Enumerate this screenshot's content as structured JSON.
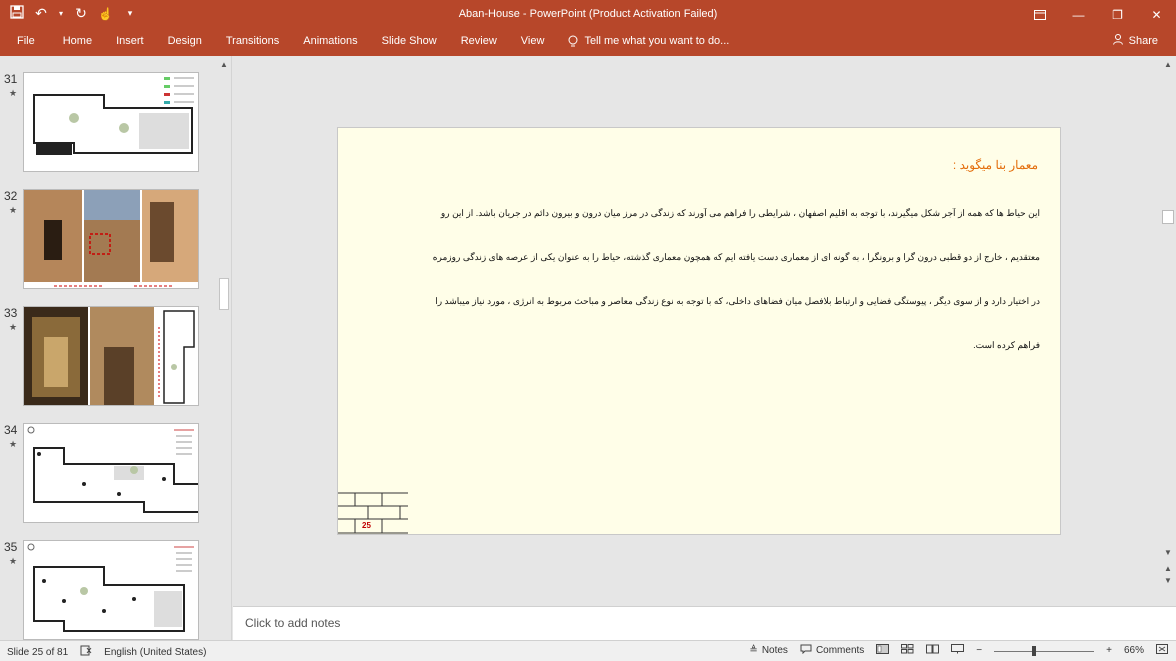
{
  "titlebar": {
    "title": "Aban-House  -  PowerPoint (Product Activation Failed)",
    "qat_icons": [
      "save-icon",
      "undo-icon",
      "redo-icon",
      "touch-mode-icon",
      "customize-icon"
    ]
  },
  "ribbon": {
    "tabs": [
      "File",
      "Home",
      "Insert",
      "Design",
      "Transitions",
      "Animations",
      "Slide Show",
      "Review",
      "View"
    ],
    "tell_me": "Tell me what you want to do...",
    "share": "Share"
  },
  "thumbnails": [
    {
      "num": "31",
      "star": "★"
    },
    {
      "num": "32",
      "star": "★"
    },
    {
      "num": "33",
      "star": "★"
    },
    {
      "num": "34",
      "star": "★"
    },
    {
      "num": "35",
      "star": "★"
    }
  ],
  "slide": {
    "heading": "معمار بنا میگوید :",
    "paragraphs": [
      "این حیاط ها که همه از آجر شکل میگیرند، با توجه به اقلیم اصفهان ، شرایطی را فراهم می آورند که زندگی در مرز میان درون و بیرون دائم در جریان باشد. از این رو",
      "معتقدیم ، خارج از دو قطبی درون گرا و برونگرا ، به گونه ای از معماری دست یافته ایم که همچون معماری گذشته، حیاط را به عنوان یکی از عرصه های زندگی روزمره",
      "در اختیار دارد و از سوی دیگر ، پیوستگی فضایی و ارتباط بلافصل میان فضاهای داخلی، که با توجه به نوع زندگی معاصر و مباحث مربوط به انرژی ، مورد نیاز میباشد را",
      "فراهم کرده است."
    ],
    "slide_number": "25"
  },
  "notes": {
    "placeholder": "Click to add notes"
  },
  "status": {
    "slide_info": "Slide 25 of 81",
    "language": "English (United States)",
    "notes_label": "Notes",
    "comments_label": "Comments",
    "zoom": "66%",
    "zoom_fraction": 0.4
  },
  "colors": {
    "accent": "#b7472a",
    "slide_bg": "#fffee8",
    "heading": "#e36c0a",
    "slide_number": "#c00000"
  }
}
